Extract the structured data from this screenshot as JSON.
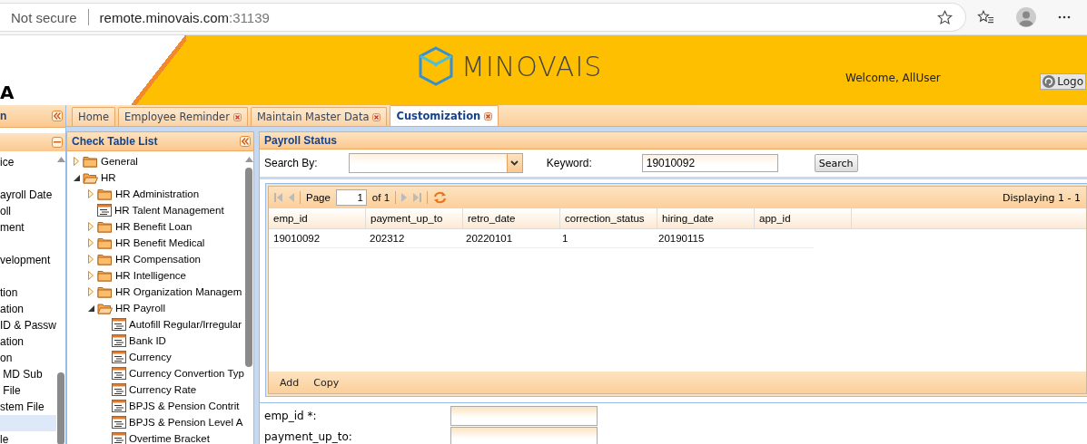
{
  "browser": {
    "security": "Not secure",
    "url_host": "remote.minovais.com",
    "url_port": ":31139"
  },
  "header": {
    "left_text": "A",
    "logo_text": "MINOVAIS",
    "welcome": "Welcome, AllUser",
    "logout": "Logo"
  },
  "left_panel": {
    "title": "n",
    "items": [
      {
        "label": "ice",
        "selected": false
      },
      {
        "selected": false
      },
      {
        "label": "ayroll Date",
        "selected": false
      },
      {
        "label": "oll",
        "selected": false
      },
      {
        "label": "ment",
        "selected": false
      },
      {
        "selected": false
      },
      {
        "label": "velopment",
        "selected": false
      },
      {
        "selected": false
      },
      {
        "label": "tion",
        "selected": false
      },
      {
        "label": "ation",
        "selected": false
      },
      {
        "label": "ID & Passw",
        "selected": false
      },
      {
        "label": "ation",
        "selected": false
      },
      {
        "label": "on",
        "selected": false
      },
      {
        "label": " MD Sub",
        "selected": false
      },
      {
        "label": " File",
        "selected": false
      },
      {
        "label": "stem File",
        "selected": false
      },
      {
        "selected": true
      },
      {
        "label": "le",
        "selected": false
      }
    ]
  },
  "tabs": [
    {
      "label": "Home",
      "closable": false,
      "selected": false
    },
    {
      "label": "Employee Reminder",
      "closable": true,
      "selected": false
    },
    {
      "label": "Maintain Master Data",
      "closable": true,
      "selected": false
    },
    {
      "label": "Customization",
      "closable": true,
      "selected": true
    }
  ],
  "tree": {
    "title": "Check Table List",
    "items": [
      {
        "label": "General",
        "kind": "folder",
        "expanded": false
      },
      {
        "label": "HR",
        "kind": "folder",
        "expanded": true,
        "children": [
          {
            "label": "HR Administration",
            "kind": "folder",
            "expanded": false
          },
          {
            "label": "HR Talent Management",
            "kind": "leaf"
          },
          {
            "label": "HR Benefit Loan",
            "kind": "folder",
            "expanded": false
          },
          {
            "label": "HR Benefit Medical",
            "kind": "folder",
            "expanded": false
          },
          {
            "label": "HR Compensation",
            "kind": "folder",
            "expanded": false
          },
          {
            "label": "HR Intelligence",
            "kind": "folder",
            "expanded": false
          },
          {
            "label": "HR Organization Managem",
            "kind": "folder",
            "expanded": false
          },
          {
            "label": "HR Payroll",
            "kind": "folder",
            "expanded": true,
            "children": [
              {
                "label": "Autofill Regular/Irregular",
                "kind": "leaf"
              },
              {
                "label": "Bank ID",
                "kind": "leaf"
              },
              {
                "label": "Currency",
                "kind": "leaf"
              },
              {
                "label": "Currency Convertion Typ",
                "kind": "leaf"
              },
              {
                "label": "Currency Rate",
                "kind": "leaf"
              },
              {
                "label": "BPJS & Pension Contrit",
                "kind": "leaf"
              },
              {
                "label": "BPJS & Pension Level A",
                "kind": "leaf"
              },
              {
                "label": "Overtime Bracket",
                "kind": "leaf"
              }
            ]
          }
        ]
      }
    ]
  },
  "payroll": {
    "title": "Payroll Status",
    "search_by_label": "Search By:",
    "keyword_label": "Keyword:",
    "keyword": "19010092",
    "search_button": "Search",
    "pager": {
      "page_label": "Page",
      "page": "1",
      "of_label": "of 1",
      "displaying": "Displaying 1 - 1"
    },
    "columns": [
      "emp_id",
      "payment_up_to",
      "retro_date",
      "correction_status",
      "hiring_date",
      "app_id"
    ],
    "rows": [
      [
        "19010092",
        "202312",
        "20220101",
        "1",
        "20190115"
      ]
    ],
    "actions": [
      "Add",
      "Copy"
    ],
    "form": [
      {
        "label": "emp_id *:"
      },
      {
        "label": "payment_up_to:"
      }
    ]
  }
}
